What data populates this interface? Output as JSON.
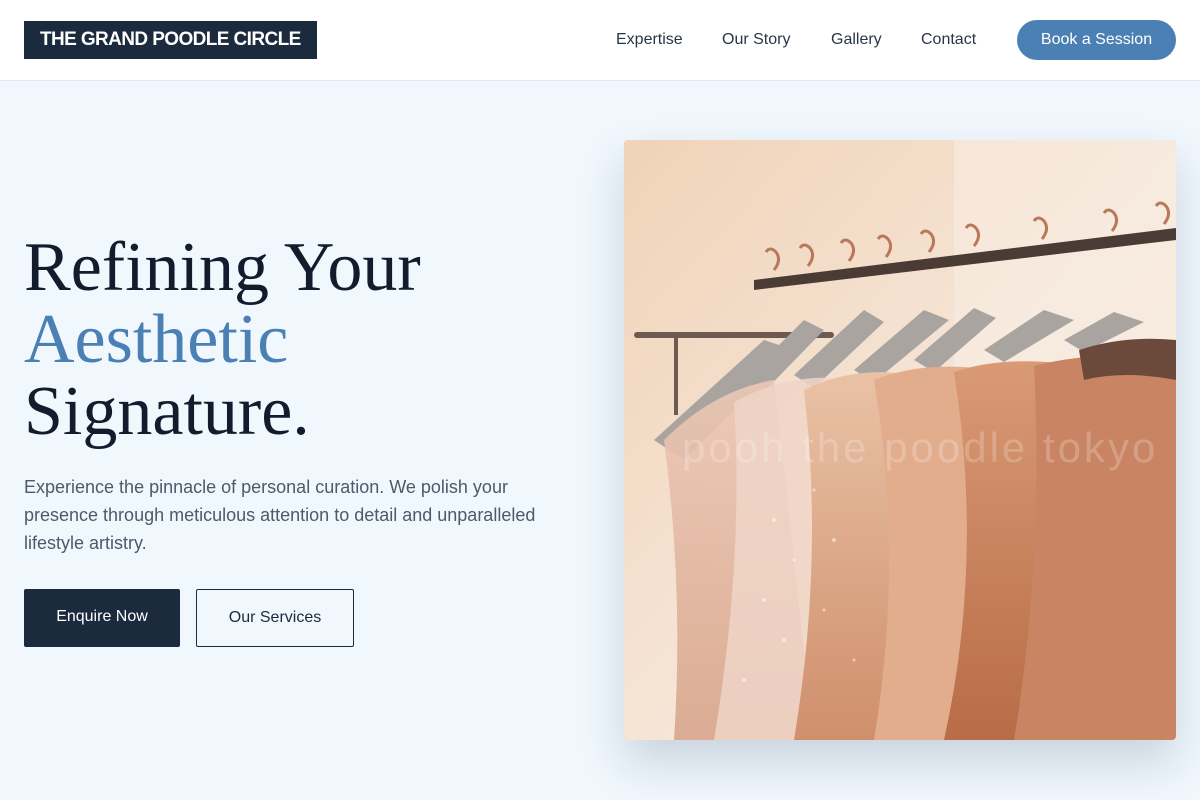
{
  "header": {
    "logo": "THE GRAND POODLE CIRCLE",
    "nav": {
      "expertise": "Expertise",
      "story": "Our Story",
      "gallery": "Gallery",
      "contact": "Contact"
    },
    "cta": "Book a Session"
  },
  "hero": {
    "headline_line1": "Refining Your",
    "headline_accent": "Aesthetic",
    "headline_line3": "Signature.",
    "description": "Experience the pinnacle of personal curation. We polish your presence through meticulous attention to detail and unparalleled lifestyle artistry.",
    "primary_button": "Enquire Now",
    "secondary_button": "Our Services",
    "image_alt": "Rack of blush and copper garments on hangers",
    "watermark": "pooh the poodle tokyo"
  },
  "colors": {
    "navy": "#1c2a3d",
    "accent": "#4a80b3",
    "background": "#f0f7fd"
  }
}
